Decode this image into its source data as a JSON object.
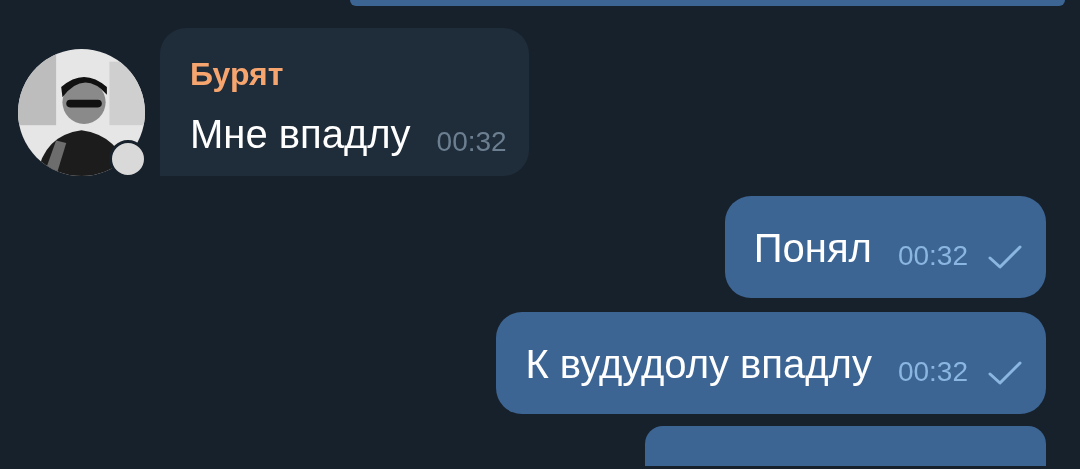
{
  "messages": [
    {
      "kind": "out-cut"
    },
    {
      "kind": "in",
      "sender": "Бурят",
      "text": "Мне впадлу",
      "time": "00:32"
    },
    {
      "kind": "out",
      "text": "Понял",
      "time": "00:32"
    },
    {
      "kind": "out",
      "text": "К вудудолу впадлу",
      "time": "00:32"
    },
    {
      "kind": "out-cut"
    }
  ]
}
